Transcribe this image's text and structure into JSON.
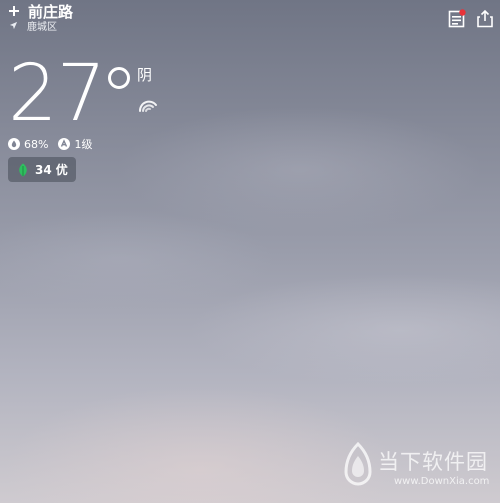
{
  "header": {
    "location_name": "前庄路",
    "district": "鹿城区",
    "left_icon": "plus-icon",
    "location_icon": "location-arrow-icon",
    "right_icons": [
      "news-icon",
      "share-icon"
    ],
    "news_badge_color": "#e8333a"
  },
  "current": {
    "temperature": "27",
    "condition": "阴",
    "condition_icon": "overcast-icon"
  },
  "stats": {
    "humidity": "68%",
    "humidity_icon": "droplet-icon",
    "wind": "1级",
    "wind_icon": "wind-icon"
  },
  "aqi": {
    "value": "34",
    "level": "优",
    "icon": "leaf-icon",
    "leaf_color": "#2fbf5f"
  },
  "watermark": {
    "name_cn": "当下软件园",
    "name_en": "www.DownXia.com"
  }
}
